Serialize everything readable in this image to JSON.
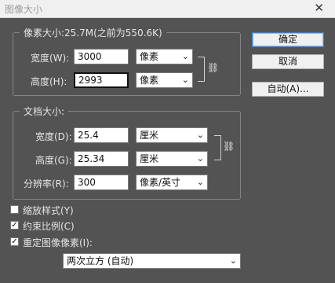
{
  "window": {
    "title": "图像大小",
    "close_glyph": "✕"
  },
  "pixel_dimensions": {
    "legend": "像素大小:25.7M(之前为550.6K)",
    "width": {
      "label": "宽度(W):",
      "value": "3000",
      "unit": "像素"
    },
    "height": {
      "label": "高度(H):",
      "value": "2993",
      "unit": "像素"
    }
  },
  "document_size": {
    "legend": "文档大小:",
    "width": {
      "label": "宽度(D):",
      "value": "25.4",
      "unit": "厘米"
    },
    "height": {
      "label": "高度(G):",
      "value": "25.34",
      "unit": "厘米"
    },
    "resolution": {
      "label": "分辨率(R):",
      "value": "300",
      "unit": "像素/英寸"
    }
  },
  "options": {
    "scale_styles": {
      "label": "缩放样式(Y)",
      "checked": false
    },
    "constrain_proportions": {
      "label": "约束比例(C)",
      "checked": true
    },
    "resample": {
      "label": "重定图像像素(I):",
      "checked": true
    },
    "resample_method": "两次立方 (自动)"
  },
  "buttons": {
    "ok": "确定",
    "cancel": "取消",
    "auto": "自动(A)..."
  },
  "icons": {
    "dropdown": "⌄",
    "link": "⛓",
    "check": "✓"
  }
}
